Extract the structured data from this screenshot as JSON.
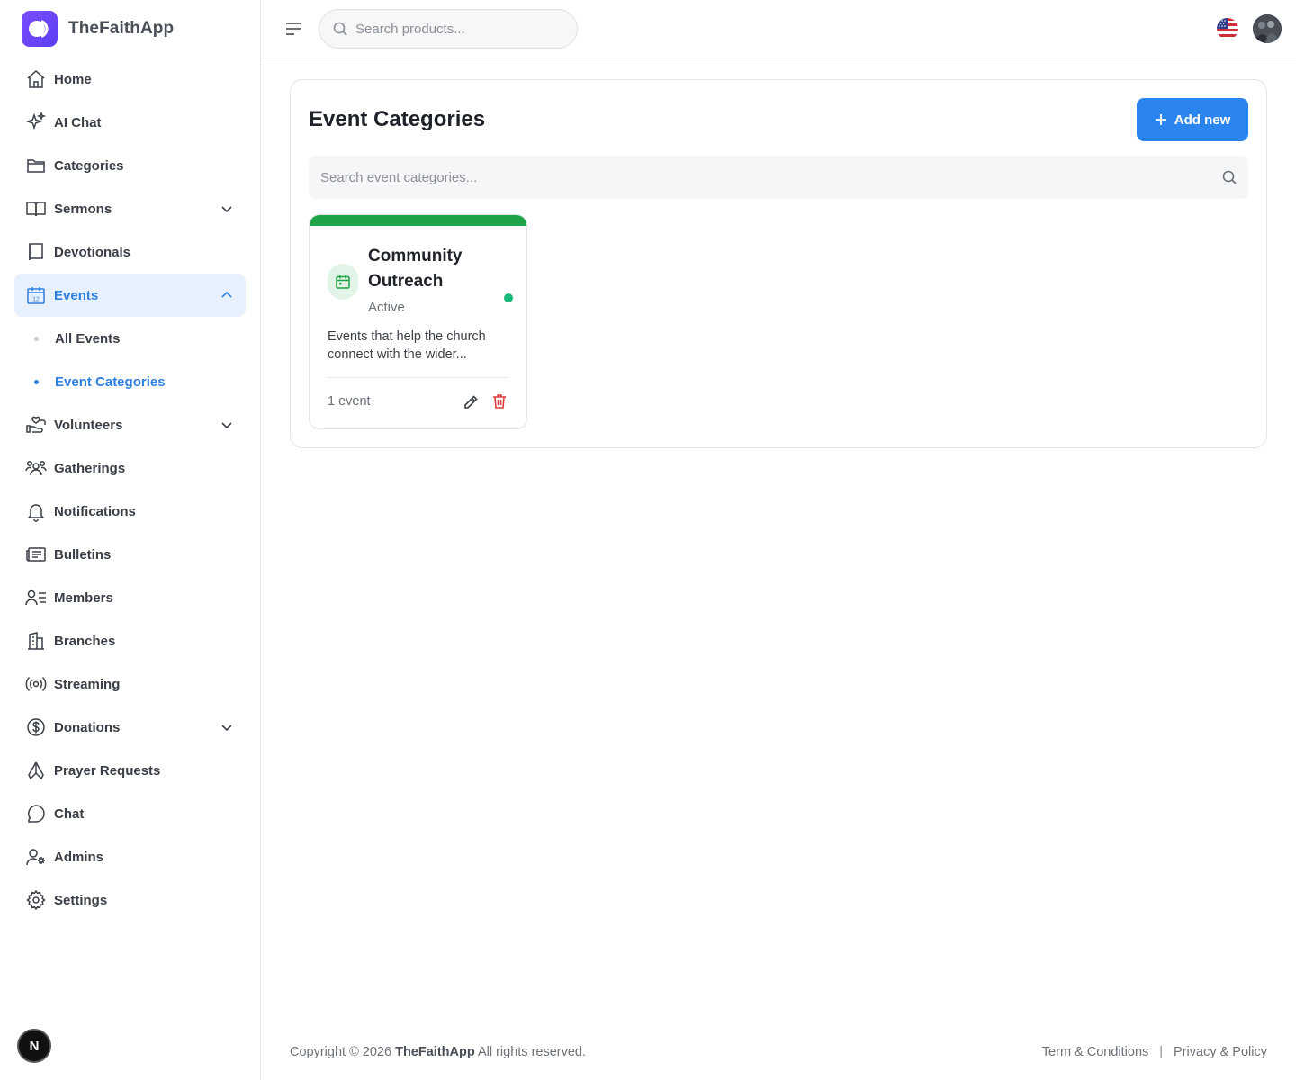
{
  "brand": {
    "name": "TheFaithApp"
  },
  "sidebar": {
    "items": [
      {
        "label": "Home",
        "icon": "home-icon"
      },
      {
        "label": "AI Chat",
        "icon": "sparkles-icon"
      },
      {
        "label": "Categories",
        "icon": "folder-icon"
      },
      {
        "label": "Sermons",
        "icon": "book-open-icon",
        "expandable": true
      },
      {
        "label": "Devotionals",
        "icon": "book-icon"
      },
      {
        "label": "Events",
        "icon": "calendar-icon",
        "expandable": true,
        "expanded": true,
        "active": true
      },
      {
        "label": "All Events",
        "sub": true
      },
      {
        "label": "Event Categories",
        "sub": true,
        "active": true
      },
      {
        "label": "Volunteers",
        "icon": "hand-heart-icon",
        "expandable": true
      },
      {
        "label": "Gatherings",
        "icon": "users-group-icon"
      },
      {
        "label": "Notifications",
        "icon": "bell-icon"
      },
      {
        "label": "Bulletins",
        "icon": "newspaper-icon"
      },
      {
        "label": "Members",
        "icon": "user-list-icon"
      },
      {
        "label": "Branches",
        "icon": "building-icon"
      },
      {
        "label": "Streaming",
        "icon": "broadcast-icon"
      },
      {
        "label": "Donations",
        "icon": "dollar-circle-icon",
        "expandable": true
      },
      {
        "label": "Prayer Requests",
        "icon": "praying-hands-icon"
      },
      {
        "label": "Chat",
        "icon": "chat-bubble-icon"
      },
      {
        "label": "Admins",
        "icon": "user-cog-icon"
      },
      {
        "label": "Settings",
        "icon": "gear-icon"
      }
    ]
  },
  "header": {
    "search_placeholder": "Search products..."
  },
  "main": {
    "title": "Event Categories",
    "add_label": "Add new",
    "search_placeholder": "Search event categories...",
    "categories": [
      {
        "name": "Community Outreach",
        "status": "Active",
        "description": "Events that help the church connect with the wider...",
        "count": "1 event",
        "color": "#1fa347"
      }
    ]
  },
  "footer": {
    "copyright_prefix": "Copyright © 2026",
    "brand": "TheFaithApp",
    "copyright_suffix": "All rights reserved.",
    "terms": "Term & Conditions",
    "separator": "|",
    "privacy": "Privacy & Policy"
  },
  "colors": {
    "accent": "#2a85f0",
    "brand": "#6a45f5",
    "active_bg": "#e7f1fd",
    "success": "#17b978",
    "danger": "#e23b3b"
  },
  "dev_badge": "N"
}
